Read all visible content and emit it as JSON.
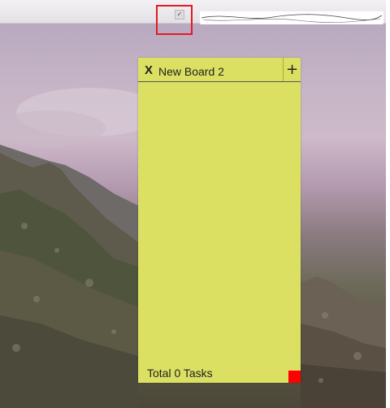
{
  "board": {
    "title": "New Board 2",
    "close_label": "X",
    "add_label": "+",
    "total_text": "Total 0 Tasks"
  },
  "menubar": {
    "tray_icon": "checklist-icon",
    "highlight_color": "#e11b22"
  },
  "colors": {
    "board_background": "#dbe062",
    "resize_handle": "#ff0000"
  }
}
